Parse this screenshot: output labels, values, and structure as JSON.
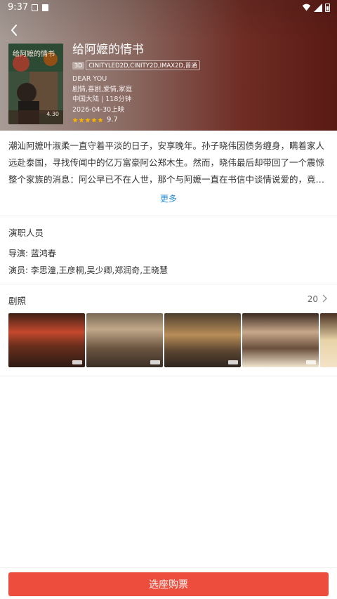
{
  "status_bar": {
    "time": "9:37",
    "icons": [
      "notification-square-icon",
      "notification-a-icon",
      "wifi-icon",
      "signal-icon",
      "battery-icon"
    ]
  },
  "movie": {
    "title": "给阿嬷的情书",
    "tag_3d": "3D",
    "formats": "CINITYLED2D,CINITY2D,IMAX2D,普通",
    "english_title": "DEAR YOU",
    "genres": "剧情,喜剧,爱情,家庭",
    "region_duration": "中国大陆 | 118分钟",
    "release": "2026-04-30上映",
    "rating_stars": 5,
    "rating_score": "9.7",
    "poster": {
      "title": "给阿嬷的情书",
      "date": "4.30"
    }
  },
  "synopsis": {
    "text": "潮汕阿嬷叶淑柔一直守着平淡的日子，安享晚年。孙子晓伟因债务缠身，瞒着家人远赴泰国，寻找传闻中的亿万富豪阿公郑木生。然而，晓伟最后却带回了一个震惊整个家族的消息：阿公早已不在人世，那个与阿嬷一直在书信中谈情说爱的，竟是一个陌生人。随着晓伟…",
    "more_label": "更多"
  },
  "cast": {
    "section_title": "演职人员",
    "director": "导演: 蓝鸿春",
    "actors": "演员: 李思潼,王彦桐,吴少卿,郑润奇,王晓慧"
  },
  "stills": {
    "section_title": "剧照",
    "count": "20"
  },
  "buy": {
    "label": "选座购票"
  },
  "colors": {
    "accent": "#ec4d3c",
    "link": "#2c8fd8",
    "star": "#f7b500"
  }
}
